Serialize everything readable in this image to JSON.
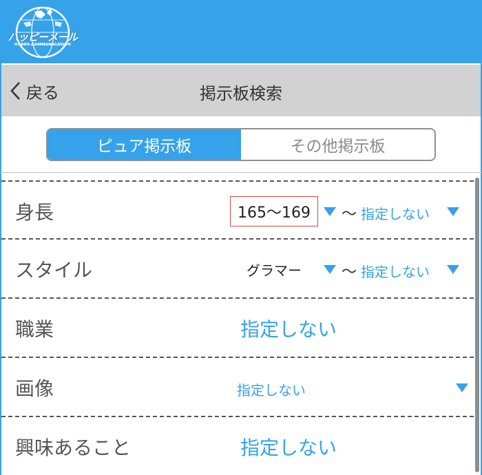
{
  "header": {
    "logo_text": "ハッピーメール",
    "logo_subtext": "HAPPY COMMUNICATION",
    "brand_color": "#35a2ea"
  },
  "nav": {
    "back_label": "戻る",
    "back_icon": "chevron-left-icon",
    "title": "掲示板検索"
  },
  "tabs": [
    {
      "label": "ピュア掲示板",
      "active": true
    },
    {
      "label": "その他掲示板",
      "active": false
    }
  ],
  "form": {
    "rows": [
      {
        "label": "身長",
        "from_value": "165〜169",
        "separator": "〜",
        "to_value": "指定しない"
      },
      {
        "label": "スタイル",
        "from_value": "グラマー",
        "separator": "〜",
        "to_value": "指定しない"
      },
      {
        "label": "職業",
        "value": "指定しない"
      },
      {
        "label": "画像",
        "value": "指定しない"
      },
      {
        "label": "興味あること",
        "value": "指定しない"
      }
    ]
  },
  "colors": {
    "accent": "#35a2ea",
    "nav_background": "#d2d2d2",
    "highlight_box": "#d64646"
  }
}
